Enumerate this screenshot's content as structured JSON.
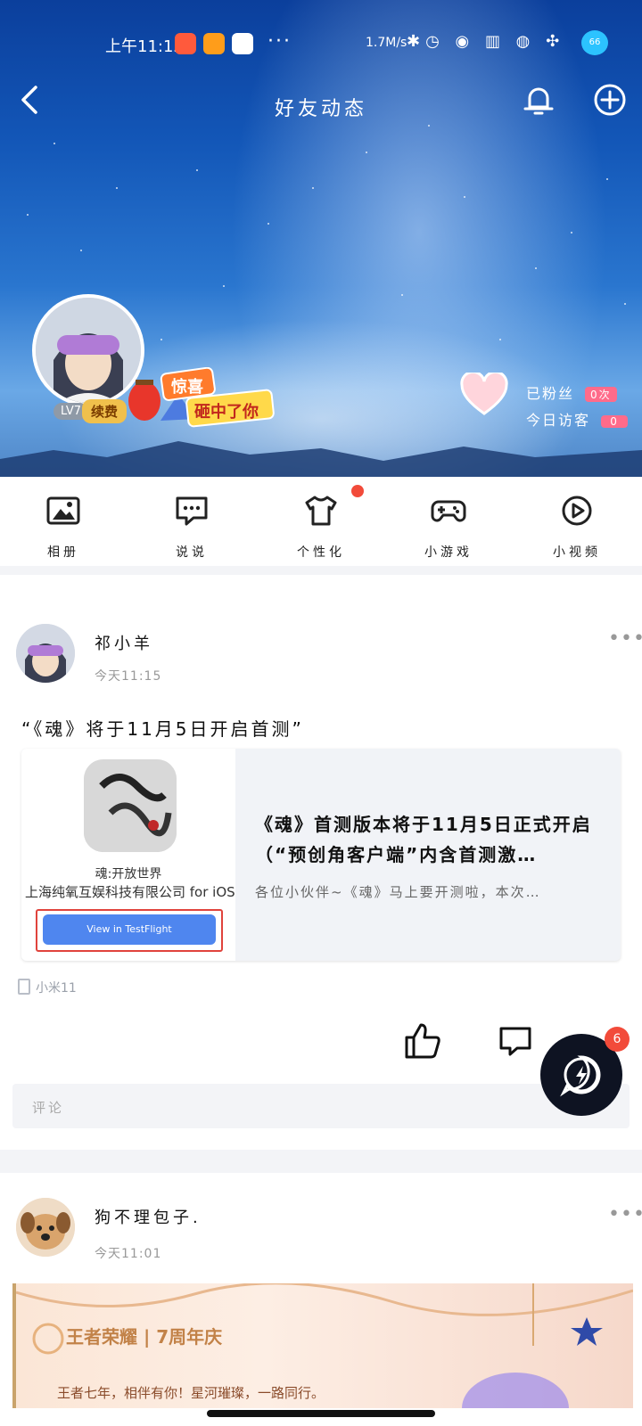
{
  "status_bar": {
    "time": "上午11:15",
    "more": "···",
    "net_speed": "1.7M/s",
    "battery": "66"
  },
  "header": {
    "title": "好友动态"
  },
  "profile": {
    "level": "LV7",
    "renew": "续费",
    "sticker_text_1": "惊喜",
    "sticker_text_2": "砸中了你",
    "visitors_label": "已粉丝",
    "visitors_count": "0次",
    "today_label": "今日访客",
    "today_count": "0"
  },
  "shortcuts": [
    {
      "label": "相册",
      "icon": "photo-icon"
    },
    {
      "label": "说说",
      "icon": "chat-bubble-icon"
    },
    {
      "label": "个性化",
      "icon": "tshirt-icon"
    },
    {
      "label": "小游戏",
      "icon": "gamepad-icon"
    },
    {
      "label": "小视频",
      "icon": "play-icon"
    }
  ],
  "posts": [
    {
      "author": "祁小羊",
      "time": "今天11:15",
      "text": "“《魂》将于11月5日开启首测”",
      "card": {
        "app_title": "魂:开放世界",
        "app_company": "上海纯氧互娱科技有限公司 for iOS",
        "button": "View in TestFlight",
        "headline": "《魂》首测版本将于11月5日正式开启（“预创角客户端”内含首测激…",
        "summary": "各位小伙伴~《魂》马上要开测啦，本次…"
      },
      "device": "小米11",
      "comment_placeholder": "评论"
    },
    {
      "author": "狗不理包子.",
      "time": "今天11:01",
      "banner": {
        "logo": "王者荣耀 | 7周年庆",
        "slogan": "王者七年，相伴有你！星河璀璨，一路同行。"
      }
    }
  ],
  "fab": {
    "badge": "6"
  },
  "colors": {
    "accent_red": "#f24b3a",
    "button_blue": "#4f86ef",
    "fab_dark": "#0e1322"
  }
}
